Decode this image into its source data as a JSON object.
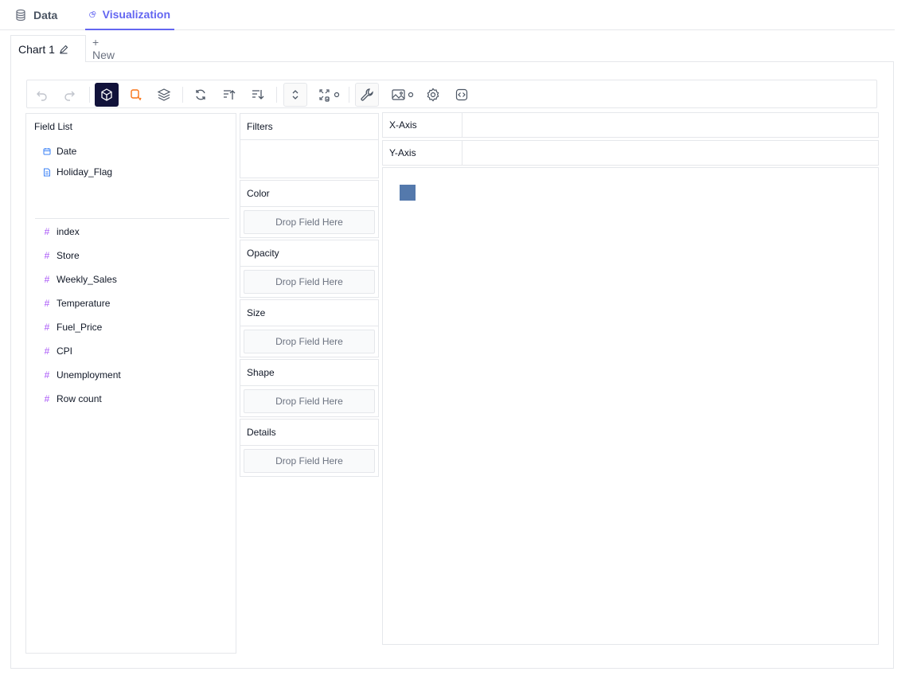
{
  "top_tabs": {
    "data_label": "Data",
    "visualization_label": "Visualization"
  },
  "chart_tabs": {
    "active_label": "Chart 1",
    "new_label": "+ New"
  },
  "toolbar": {
    "items": [
      "undo-icon",
      "redo-icon",
      "cube-icon",
      "paint-icon",
      "layers-icon",
      "refresh-icon",
      "sort-ascending-icon",
      "sort-descending-icon",
      "expand-collapse-icon",
      "resize-icon",
      "wrench-icon",
      "image-export-icon",
      "settings-icon",
      "code-icon"
    ]
  },
  "field_list": {
    "title": "Field List",
    "dimensions": [
      {
        "label": "Date",
        "icon": "calendar-icon"
      },
      {
        "label": "Holiday_Flag",
        "icon": "text-file-icon"
      }
    ],
    "measures": [
      {
        "label": "index",
        "icon": "hash-icon"
      },
      {
        "label": "Store",
        "icon": "hash-icon"
      },
      {
        "label": "Weekly_Sales",
        "icon": "hash-icon"
      },
      {
        "label": "Temperature",
        "icon": "hash-icon"
      },
      {
        "label": "Fuel_Price",
        "icon": "hash-icon"
      },
      {
        "label": "CPI",
        "icon": "hash-icon"
      },
      {
        "label": "Unemployment",
        "icon": "hash-icon"
      },
      {
        "label": "Row count",
        "icon": "hash-icon"
      }
    ]
  },
  "encodings": {
    "filters": "Filters",
    "color": "Color",
    "opacity": "Opacity",
    "size": "Size",
    "shape": "Shape",
    "details": "Details",
    "drop_placeholder": "Drop Field Here"
  },
  "axes": {
    "x_label": "X-Axis",
    "y_label": "Y-Axis"
  },
  "colors": {
    "accent": "#6366f1",
    "active_tool": "#11123a",
    "mark": "#5479ac",
    "measure_hash": "#a855f7"
  }
}
